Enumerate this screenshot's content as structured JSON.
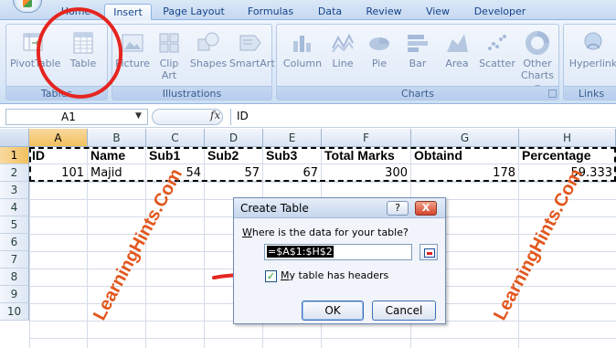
{
  "tabs": [
    {
      "label": "Home",
      "active": false
    },
    {
      "label": "Insert",
      "active": true
    },
    {
      "label": "Page Layout",
      "active": false
    },
    {
      "label": "Formulas",
      "active": false
    },
    {
      "label": "Data",
      "active": false
    },
    {
      "label": "Review",
      "active": false
    },
    {
      "label": "View",
      "active": false
    },
    {
      "label": "Developer",
      "active": false
    }
  ],
  "ribbon": {
    "groups": [
      {
        "label": "Tables",
        "buttons": [
          "PivotTable",
          "Table"
        ]
      },
      {
        "label": "Illustrations",
        "buttons": [
          "Picture",
          "Clip Art",
          "Shapes",
          "SmartArt"
        ]
      },
      {
        "label": "Charts",
        "buttons": [
          "Column",
          "Line",
          "Pie",
          "Bar",
          "Area",
          "Scatter",
          "Other Charts"
        ]
      },
      {
        "label": "Links",
        "buttons": [
          "Hyperlink"
        ]
      }
    ],
    "clip_line1": "Clip",
    "clip_line2": "Art",
    "other_line1": "Other",
    "other_line2": "Charts ▾"
  },
  "formula_bar": {
    "name_box": "A1",
    "fx": "fx",
    "value": "ID"
  },
  "columns": [
    "A",
    "B",
    "C",
    "D",
    "E",
    "F",
    "G",
    "H"
  ],
  "rows": [
    "1",
    "2",
    "3",
    "4",
    "5",
    "6",
    "7",
    "8",
    "9",
    "10"
  ],
  "cells": {
    "row1": [
      "ID",
      "Name",
      "Sub1",
      "Sub2",
      "Sub3",
      "Total Marks",
      "Obtaind",
      "Percentage"
    ],
    "row2": [
      "101",
      "Majid",
      "54",
      "57",
      "67",
      "300",
      "178",
      "59.333"
    ]
  },
  "watermark": "LearningHints.Com",
  "dialog": {
    "title": "Create Table",
    "help": "?",
    "close": "X",
    "prompt_pre": "",
    "prompt_accel": "W",
    "prompt_post": "here is the data for your table?",
    "range": "=$A$1:$H$2",
    "checkbox_label_accel": "M",
    "checkbox_label_rest": "y table has headers",
    "checkbox_checked": true,
    "ok": "OK",
    "cancel": "Cancel"
  },
  "colors": {
    "annotation_red": "#e5251f",
    "watermark_orange": "#e2571e",
    "selected_header": "#f1c15f"
  }
}
